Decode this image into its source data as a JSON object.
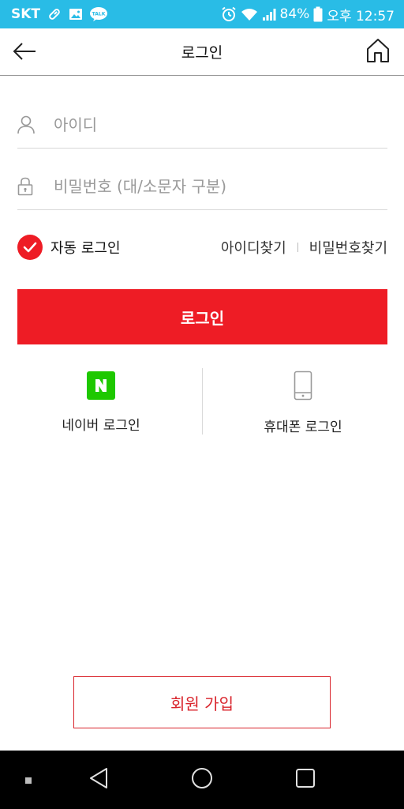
{
  "status_bar": {
    "carrier": "SKT",
    "battery": "84%",
    "time": "오후 12:57",
    "icons": [
      "pill-icon",
      "image-icon",
      "kakaotalk-icon",
      "alarm-icon",
      "wifi-icon",
      "signal-icon",
      "battery-icon"
    ]
  },
  "header": {
    "title": "로그인"
  },
  "form": {
    "id_placeholder": "아이디",
    "password_placeholder": "비밀번호 (대/소문자 구분)"
  },
  "options": {
    "auto_login_label": "자동 로그인",
    "auto_login_checked": true,
    "find_id": "아이디찾기",
    "find_password": "비밀번호찾기"
  },
  "login_button": "로그인",
  "social": {
    "naver_label": "네이버 로그인",
    "naver_logo_letter": "N",
    "phone_label": "휴대폰 로그인"
  },
  "signup_button": "회원 가입",
  "colors": {
    "status_bar": "#29bce6",
    "primary_red": "#ee1c25",
    "naver_green": "#1ec800"
  }
}
